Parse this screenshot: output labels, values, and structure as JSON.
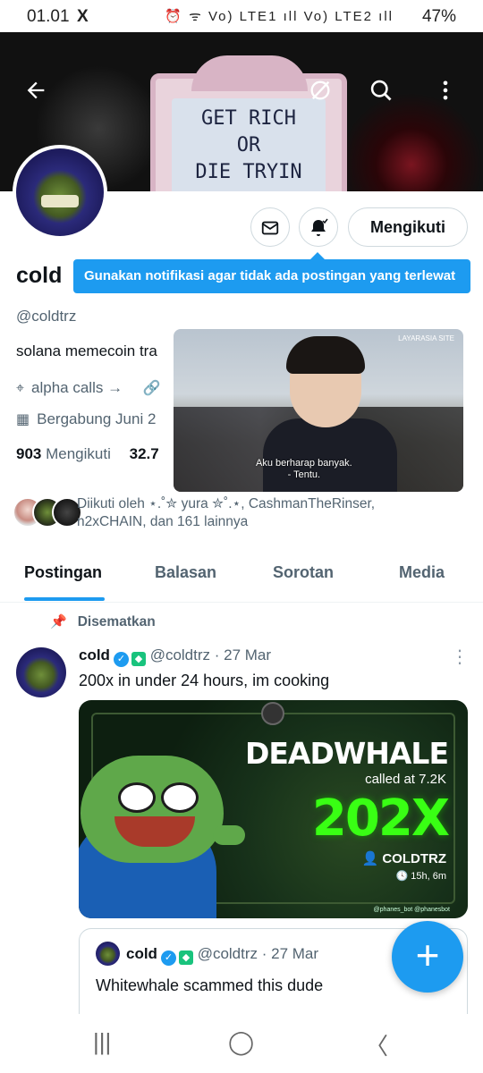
{
  "status_bar": {
    "time": "01.01",
    "app_icon": "X",
    "icons": "⏰ ᯤ Vo) LTE1 ıll Vo) LTE2 ıll",
    "battery": "47%"
  },
  "banner": {
    "sign_lines": [
      "GET RICH",
      "OR",
      "DIE TRYIN"
    ]
  },
  "header_buttons": {
    "back_icon": "arrow-left-icon",
    "grok_icon": "grok-icon",
    "search_icon": "search-icon",
    "more_icon": "more-vertical-icon"
  },
  "profile": {
    "name": "cold",
    "handle": "@coldtrz",
    "bio": "solana memecoin tra",
    "link": "alpha calls →",
    "joined": "Bergabung Juni 2",
    "following_count": "903",
    "following_label": "Mengikuti",
    "followers_count": "32.7",
    "follow_button": "Mengikuti"
  },
  "tooltip": "Gunakan notifikasi agar tidak ada postingan yang terlewat",
  "video": {
    "watermark": "LAYARASIA SITE",
    "subtitle_lines": [
      "Aku berharap banyak.",
      "- Tentu."
    ]
  },
  "followed_by": {
    "line1": "Diikuti oleh ⋆.˚✮ yura ✮˚.⋆, CashmanTheRinser,",
    "line2": "n2xCHAIN, dan 161 lainnya"
  },
  "tabs": [
    "Postingan",
    "Balasan",
    "Sorotan",
    "Media"
  ],
  "pinned_label": "Disematkan",
  "post": {
    "name": "cold",
    "handle": "@coldtrz",
    "date": "· 27 Mar",
    "text": "200x in under 24 hours, im cooking",
    "media": {
      "title": "DEADWHALE",
      "sub": "called at 7.2K",
      "multiplier": "202X",
      "user": "COLDTRZ",
      "time": "15h, 6m",
      "footer": "@phanes_bot   @phanesbot"
    }
  },
  "quote": {
    "name": "cold",
    "handle": "@coldtrz",
    "date": "· 27 Mar",
    "text": "Whitewhale scammed this dude"
  },
  "fab_label": "+",
  "navbar": [
    "|||",
    "◯",
    "〈"
  ]
}
